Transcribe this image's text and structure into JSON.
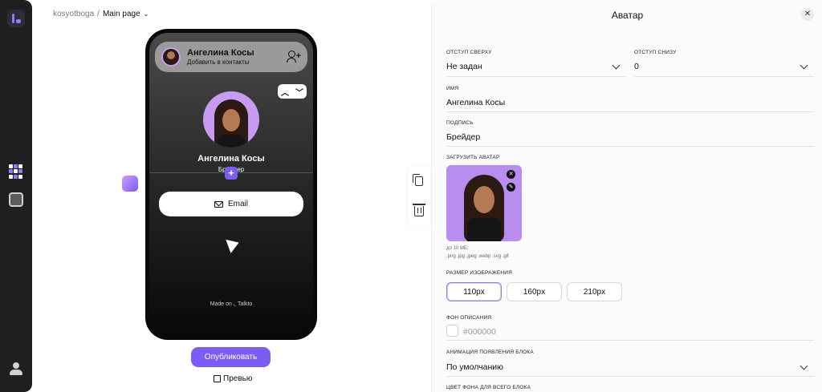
{
  "breadcrumb": {
    "workspace": "kosyotboga",
    "separator": "/",
    "page": "Main page"
  },
  "phone": {
    "contact_name": "Ангелина Косы",
    "contact_action": "Добавить в контакты",
    "profile_name": "Ангелина Косы",
    "profile_role": "Брейдер",
    "email_label": "Email",
    "made_on": "Made on",
    "brand": "Talkto"
  },
  "actions": {
    "publish": "Опубликовать",
    "preview": "Превью"
  },
  "panel": {
    "title": "Аватар",
    "top_offset_label": "Отступ сверху",
    "top_offset_value": "Не задан",
    "bottom_offset_label": "Отступ снизу",
    "bottom_offset_value": "0",
    "name_label": "Имя",
    "name_value": "Ангелина Косы",
    "caption_label": "Подпись",
    "caption_value": "Брейдер",
    "upload_label": "Загрузить аватар",
    "upload_limit": "до 10 МБ;",
    "upload_formats": ".png .jpg .jpeg .webp .svg .gif",
    "size_label": "Размер изображения",
    "sizes": [
      "110px",
      "160px",
      "210px"
    ],
    "bg_label": "Фон описания",
    "bg_value": "#000000",
    "animation_label": "Анимация появления блока",
    "animation_value": "По умолчанию",
    "page_bg_label": "Цвет фона для всего блока"
  },
  "colors": {
    "accent": "#7b5cf5",
    "avatar_bg": "#c59cf2"
  }
}
